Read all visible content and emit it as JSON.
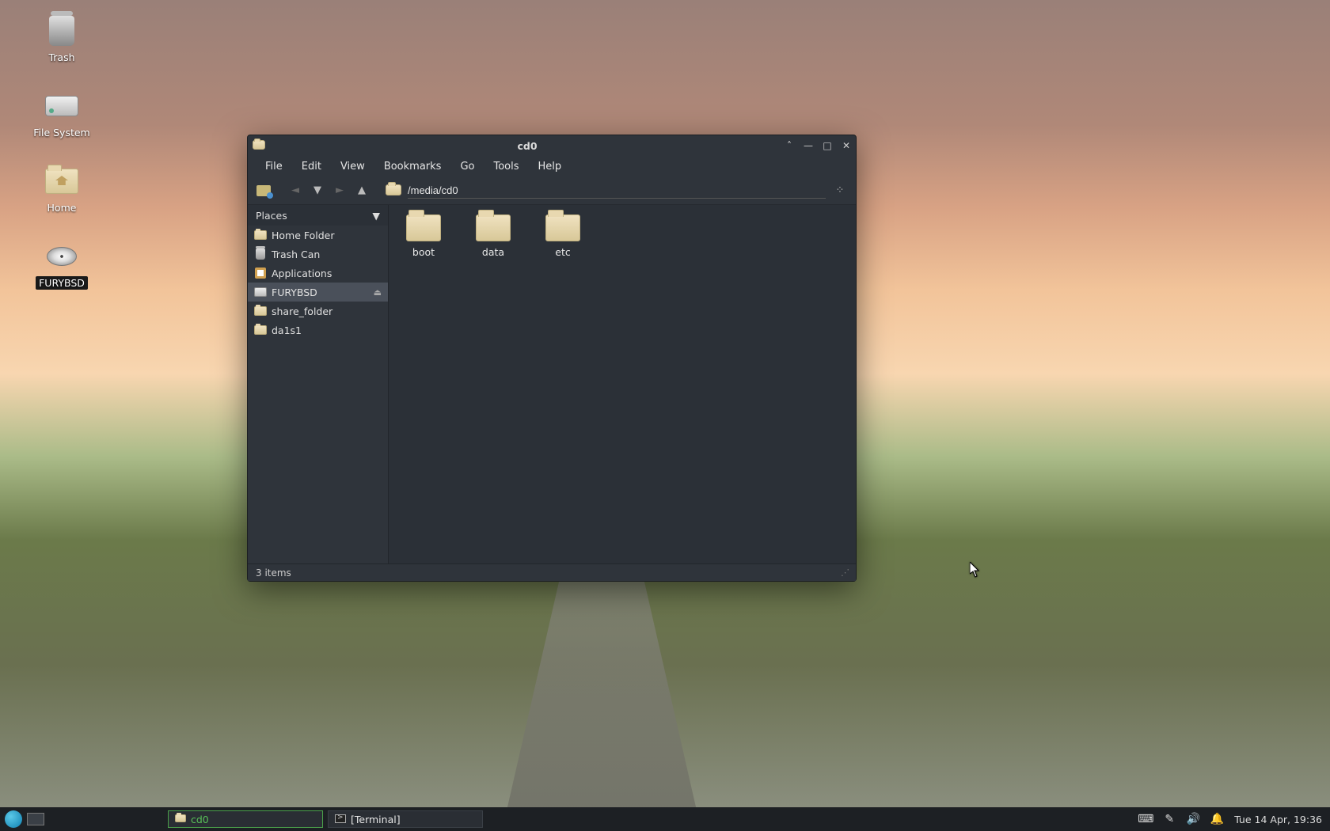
{
  "desktop": {
    "icons": [
      {
        "id": "trash",
        "label": "Trash"
      },
      {
        "id": "filesystem",
        "label": "File System"
      },
      {
        "id": "home",
        "label": "Home"
      },
      {
        "id": "furybsd",
        "label": "FURYBSD",
        "selected": true
      }
    ]
  },
  "window": {
    "title": "cd0",
    "menus": [
      "File",
      "Edit",
      "View",
      "Bookmarks",
      "Go",
      "Tools",
      "Help"
    ],
    "path": "/media/cd0",
    "sidebar": {
      "header": "Places",
      "items": [
        {
          "label": "Home Folder",
          "icon": "folder"
        },
        {
          "label": "Trash Can",
          "icon": "trash"
        },
        {
          "label": "Applications",
          "icon": "apps"
        },
        {
          "label": "FURYBSD",
          "icon": "drive",
          "selected": true,
          "ejectable": true
        },
        {
          "label": "share_folder",
          "icon": "folder"
        },
        {
          "label": "da1s1",
          "icon": "folder"
        }
      ]
    },
    "files": [
      {
        "name": "boot",
        "type": "folder"
      },
      {
        "name": "data",
        "type": "folder"
      },
      {
        "name": "etc",
        "type": "folder"
      }
    ],
    "status": "3 items"
  },
  "taskbar": {
    "tasks": [
      {
        "label": "cd0",
        "icon": "folder",
        "active": true
      },
      {
        "label": "[Terminal]",
        "icon": "terminal",
        "active": false
      }
    ],
    "clock": "Tue 14 Apr, 19:36"
  }
}
